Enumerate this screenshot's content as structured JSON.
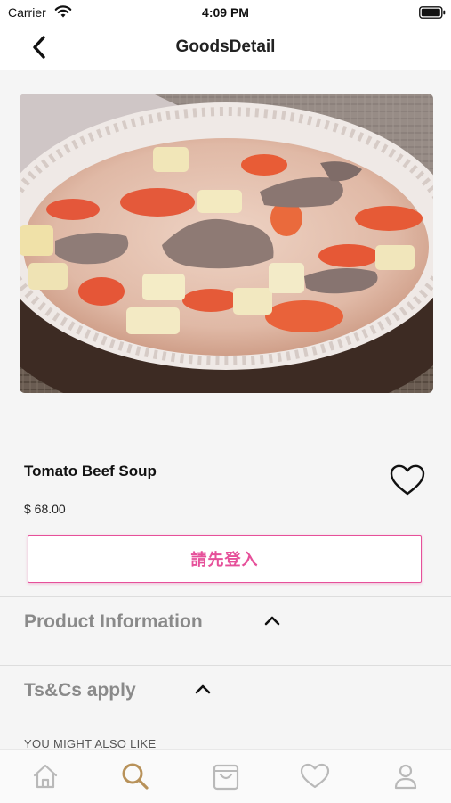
{
  "status_bar": {
    "carrier": "Carrier",
    "time": "4:09 PM"
  },
  "nav": {
    "title": "GoodsDetail",
    "back_icon": "chevron-left-icon"
  },
  "product": {
    "image_description_icon": "product-photo",
    "name": "Tomato Beef Soup",
    "price": "$ 68.00",
    "favorite_icon": "heart-outline-icon"
  },
  "login_button": {
    "label": "請先登入",
    "color": "#e6509a"
  },
  "sections": [
    {
      "title": "Product Information",
      "icon": "chevron-up-icon"
    },
    {
      "title": "Ts&Cs apply",
      "icon": "chevron-up-icon"
    }
  ],
  "recommend": {
    "label": "YOU MIGHT ALSO LIKE"
  },
  "tab_bar": {
    "active_color": "#b8925a",
    "inactive_color": "#b9b9b9",
    "items": [
      {
        "icon": "home-icon",
        "active": false
      },
      {
        "icon": "search-icon",
        "active": true
      },
      {
        "icon": "shopping-bag-icon",
        "active": false
      },
      {
        "icon": "heart-icon",
        "active": false
      },
      {
        "icon": "user-icon",
        "active": false
      }
    ]
  }
}
